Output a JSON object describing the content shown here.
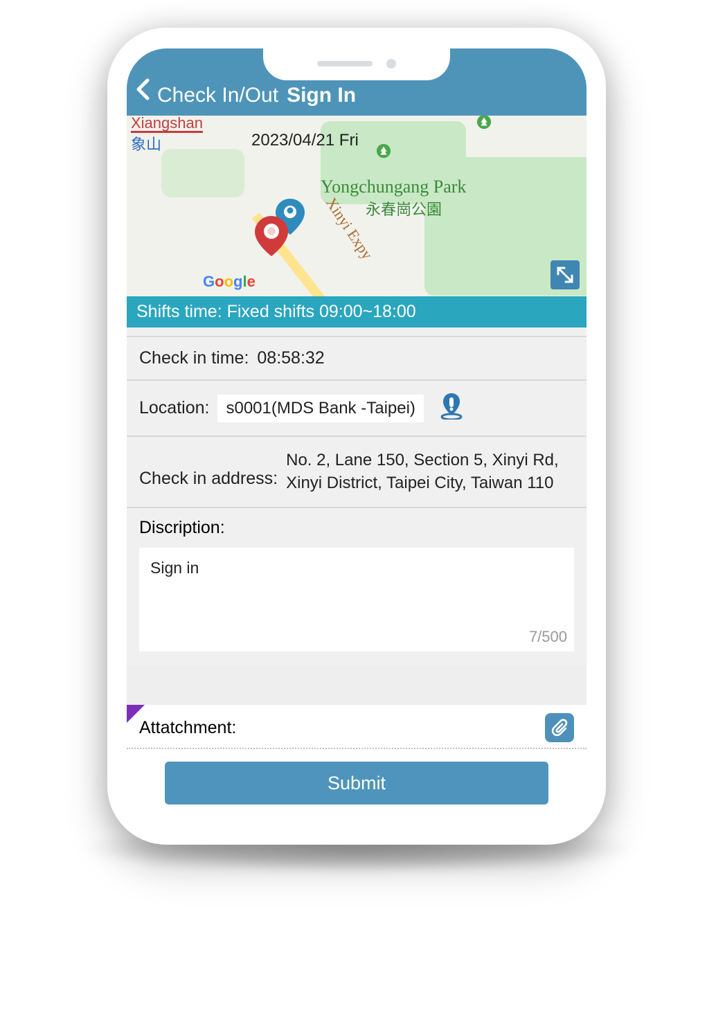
{
  "header": {
    "prev_label": "Check In/Out",
    "current_label": "Sign In"
  },
  "map": {
    "date_label": "2023/04/21 Fri",
    "metro_en": "Xiangshan",
    "metro_ch": "象山",
    "park_en": "Yongchungang Park",
    "park_ch": "永春崗公園",
    "expy_label": "Xinyi Expy",
    "attribution": "Google"
  },
  "shifts": {
    "text": "Shifts time: Fixed shifts 09:00~18:00"
  },
  "checkin": {
    "time_label": "Check in time:",
    "time_value": "08:58:32",
    "location_label": "Location:",
    "location_value": "s0001(MDS Bank -Taipei)",
    "address_label": "Check in address:",
    "address_value": "No. 2, Lane 150, Section 5, Xinyi Rd, Xinyi District, Taipei City, Taiwan 110"
  },
  "description": {
    "label": "Discription:",
    "value": "Sign in",
    "counter": "7/500"
  },
  "attachment": {
    "label": "Attatchment:"
  },
  "submit": {
    "label": "Submit"
  }
}
